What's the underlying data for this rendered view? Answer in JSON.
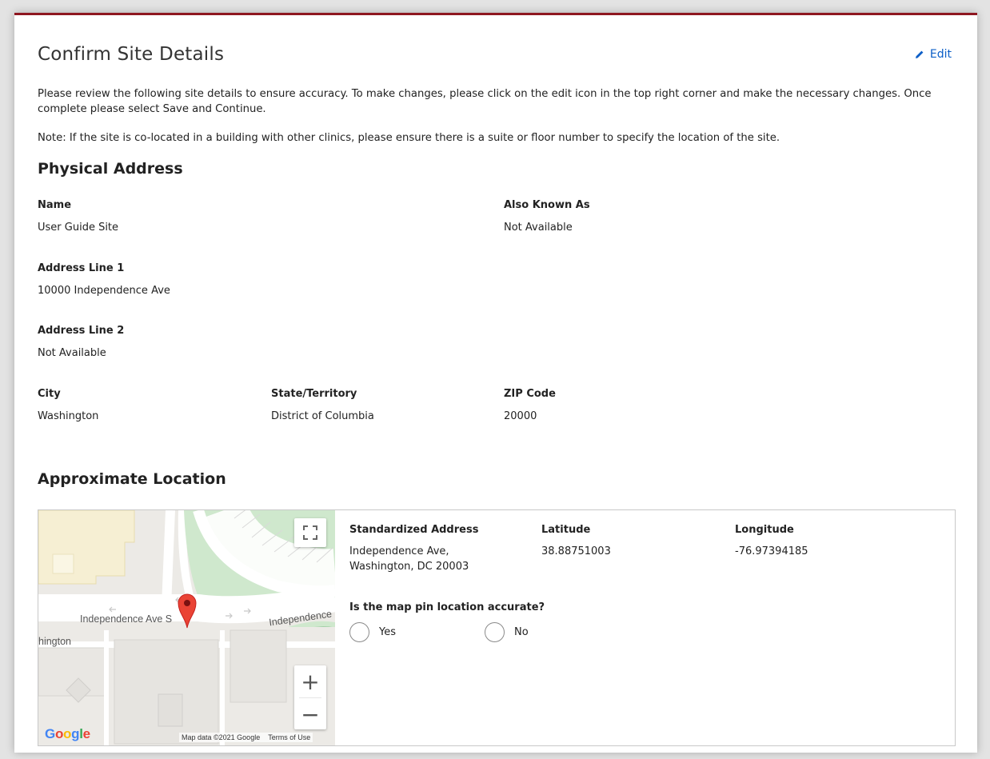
{
  "card": {
    "title": "Confirm Site Details",
    "edit_label": "Edit",
    "intro": "Please review the following site details to ensure accuracy. To make changes, please click on the edit icon in the top right corner and make the necessary changes. Once complete please select Save and Continue.",
    "note": "Note: If the site is co-located in a building with other clinics, please ensure there is a suite or floor number to specify the location of the site."
  },
  "physical": {
    "title": "Physical Address",
    "name_label": "Name",
    "name_value": "User Guide Site",
    "aka_label": "Also Known As",
    "aka_value": "Not Available",
    "addr1_label": "Address Line 1",
    "addr1_value": "10000 Independence Ave",
    "addr2_label": "Address Line 2",
    "addr2_value": "Not Available",
    "city_label": "City",
    "city_value": "Washington",
    "state_label": "State/Territory",
    "state_value": "District of Columbia",
    "zip_label": "ZIP Code",
    "zip_value": "20000"
  },
  "location": {
    "title": "Approximate Location",
    "std_label": "Standardized Address",
    "std_line1": "Independence Ave,",
    "std_line2": "Washington, DC 20003",
    "lat_label": "Latitude",
    "lat_value": "38.88751003",
    "lon_label": "Longitude",
    "lon_value": "-76.97394185",
    "question": "Is the map pin location accurate?",
    "yes_label": "Yes",
    "no_label": "No"
  },
  "map": {
    "street_label": "Independence Ave S",
    "street_label_2": "Independence",
    "city_fragment": "hington",
    "zoom_in": "+",
    "zoom_out": "−",
    "attribution": "Map data ©2021 Google",
    "terms": "Terms of Use",
    "google_letters": [
      "G",
      "o",
      "o",
      "g",
      "l",
      "e"
    ],
    "google_colors": [
      "#4285f4",
      "#ea4335",
      "#fbbc05",
      "#4285f4",
      "#34a853",
      "#ea4335"
    ],
    "pin_color": "#ea4335",
    "park_color": "#cfe8cd"
  },
  "colors": {
    "accent_bar": "#8e1620",
    "link": "#0b5ec7"
  }
}
